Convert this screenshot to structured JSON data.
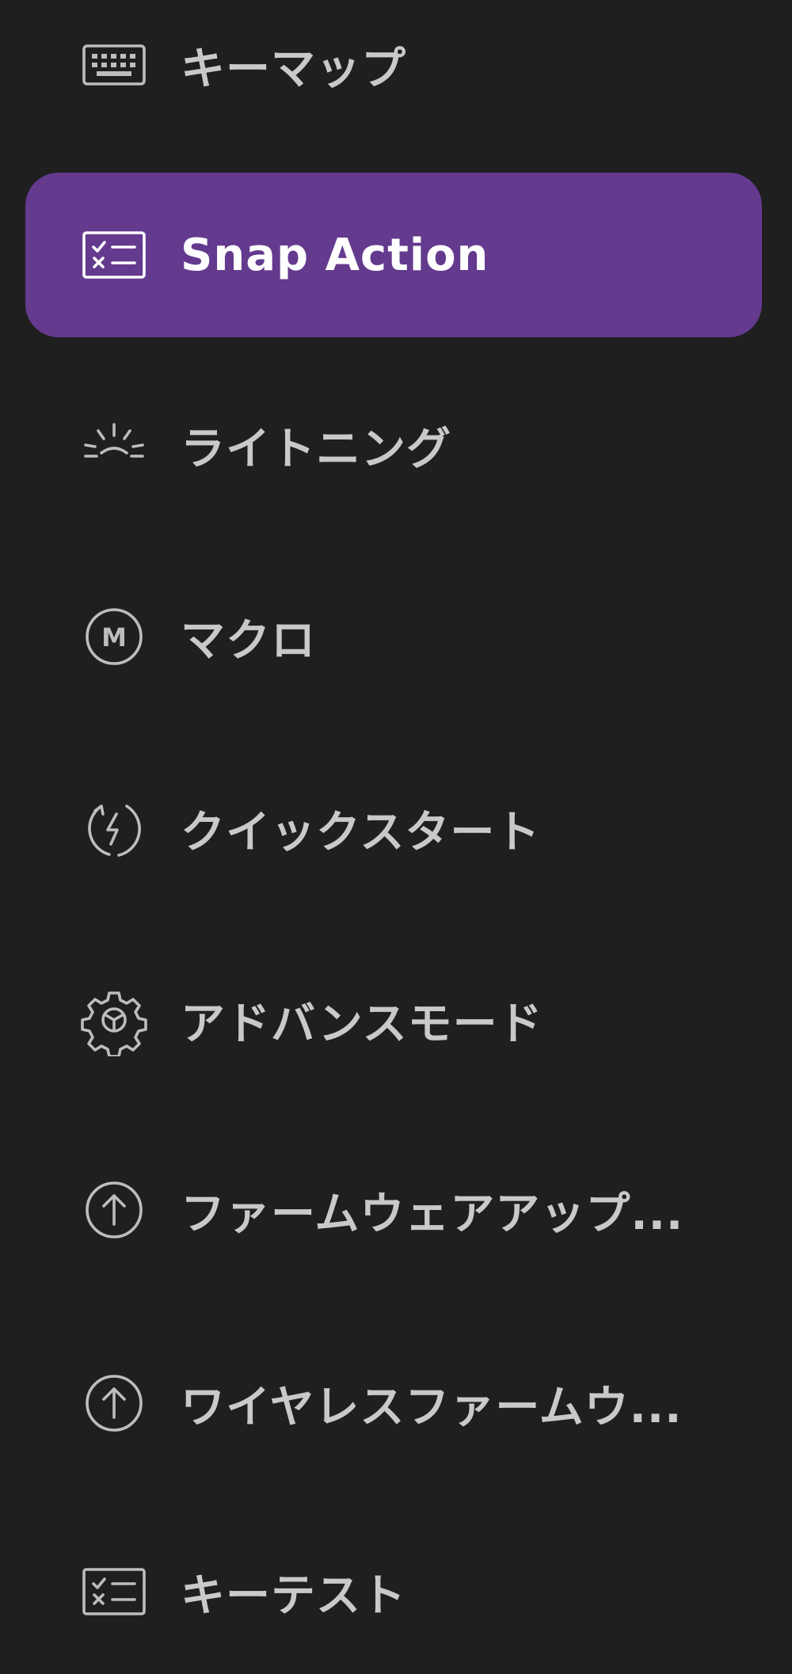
{
  "sidebar": {
    "items": [
      {
        "label": "キーマップ",
        "icon": "keyboard-icon",
        "active": false
      },
      {
        "label": "Snap Action",
        "icon": "checklist-icon",
        "active": true
      },
      {
        "label": "ライトニング",
        "icon": "sunrise-lighting-icon",
        "active": false
      },
      {
        "label": "マクロ",
        "icon": "macro-m-circle-icon",
        "active": false
      },
      {
        "label": "クイックスタート",
        "icon": "lightning-refresh-icon",
        "active": false
      },
      {
        "label": "アドバンスモード",
        "icon": "gear-icon",
        "active": false
      },
      {
        "label": "ファームウェアアップ...",
        "icon": "arrow-up-circle-icon",
        "active": false
      },
      {
        "label": "ワイヤレスファームウ...",
        "icon": "arrow-up-circle-icon",
        "active": false
      },
      {
        "label": "キーテスト",
        "icon": "checklist-icon",
        "active": false
      }
    ],
    "macro_icon_letter": "M"
  },
  "colors": {
    "background": "#1f1f1f",
    "active_background": "#643a8e",
    "text": "#c9c9c9",
    "active_text": "#ffffff"
  }
}
